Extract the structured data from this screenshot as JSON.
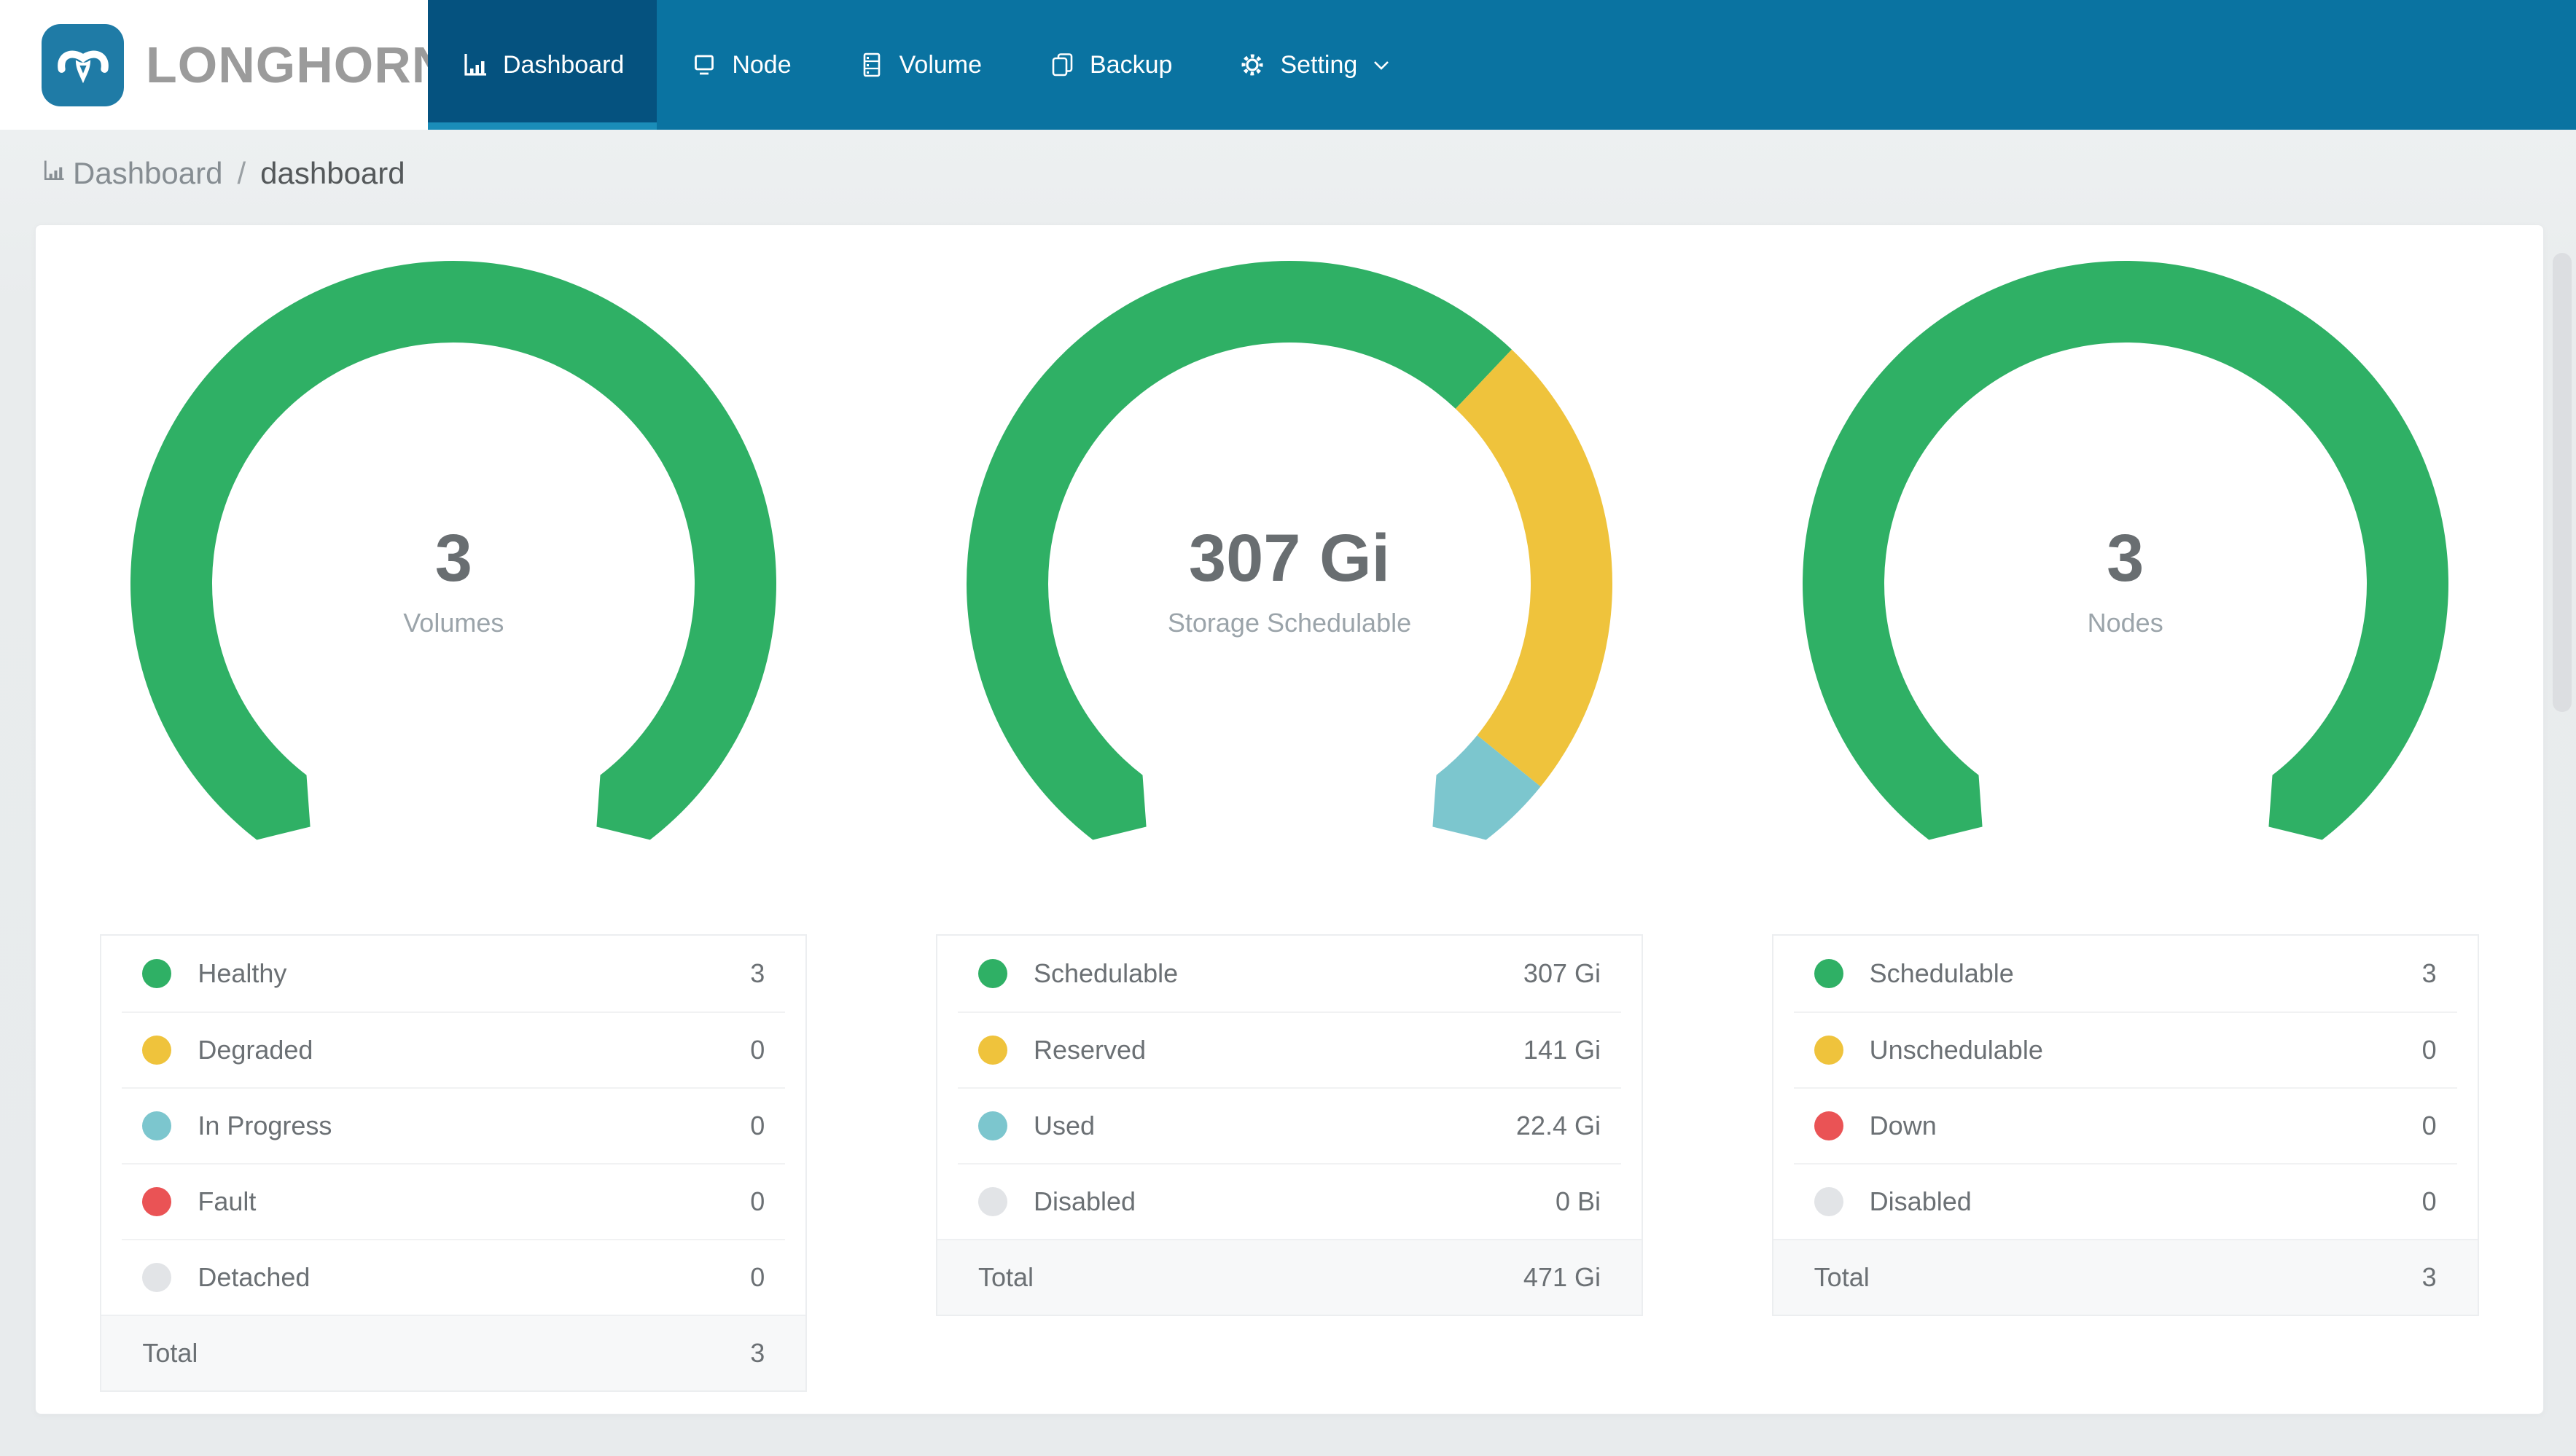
{
  "brand": {
    "name": "LONGHORN"
  },
  "nav": {
    "items": [
      {
        "label": "Dashboard",
        "active": true
      },
      {
        "label": "Node",
        "active": false
      },
      {
        "label": "Volume",
        "active": false
      },
      {
        "label": "Backup",
        "active": false
      },
      {
        "label": "Setting",
        "active": false
      }
    ]
  },
  "breadcrumb": {
    "section": "Dashboard",
    "separator": "/",
    "page": "dashboard"
  },
  "colors": {
    "nav_bar": "#0a73a1",
    "nav_active": "#05527f",
    "nav_active_strip": "#1a8db9",
    "logo_blue": "#1f7ba6",
    "green": "#2fb065",
    "yellow": "#efc33c",
    "teal": "#7cc6ce",
    "red": "#ea5355",
    "gray": "#e2e4e7"
  },
  "chart_data": [
    {
      "type": "gauge",
      "center_value": "3",
      "center_label": "Volumes",
      "arc": {
        "start_deg": -142.5,
        "sweep_deg": 285
      },
      "segments": [
        {
          "label": "Healthy",
          "value": 3,
          "display": "3",
          "color": "#2fb065"
        },
        {
          "label": "Degraded",
          "value": 0,
          "display": "0",
          "color": "#efc33c"
        },
        {
          "label": "In Progress",
          "value": 0,
          "display": "0",
          "color": "#7cc6ce"
        },
        {
          "label": "Fault",
          "value": 0,
          "display": "0",
          "color": "#ea5355"
        },
        {
          "label": "Detached",
          "value": 0,
          "display": "0",
          "color": "#e2e4e7"
        }
      ],
      "total": {
        "label": "Total",
        "display": "3"
      }
    },
    {
      "type": "gauge",
      "center_value": "307 Gi",
      "center_label": "Storage Schedulable",
      "arc": {
        "start_deg": -142.5,
        "sweep_deg": 285
      },
      "segments": [
        {
          "label": "Schedulable",
          "value": 307,
          "display": "307 Gi",
          "color": "#2fb065"
        },
        {
          "label": "Reserved",
          "value": 141,
          "display": "141 Gi",
          "color": "#efc33c"
        },
        {
          "label": "Used",
          "value": 22.4,
          "display": "22.4 Gi",
          "color": "#7cc6ce"
        },
        {
          "label": "Disabled",
          "value": 0,
          "display": "0 Bi",
          "color": "#e2e4e7"
        }
      ],
      "total": {
        "label": "Total",
        "display": "471 Gi"
      }
    },
    {
      "type": "gauge",
      "center_value": "3",
      "center_label": "Nodes",
      "arc": {
        "start_deg": -142.5,
        "sweep_deg": 285
      },
      "segments": [
        {
          "label": "Schedulable",
          "value": 3,
          "display": "3",
          "color": "#2fb065"
        },
        {
          "label": "Unschedulable",
          "value": 0,
          "display": "0",
          "color": "#efc33c"
        },
        {
          "label": "Down",
          "value": 0,
          "display": "0",
          "color": "#ea5355"
        },
        {
          "label": "Disabled",
          "value": 0,
          "display": "0",
          "color": "#e2e4e7"
        }
      ],
      "total": {
        "label": "Total",
        "display": "3"
      }
    }
  ]
}
